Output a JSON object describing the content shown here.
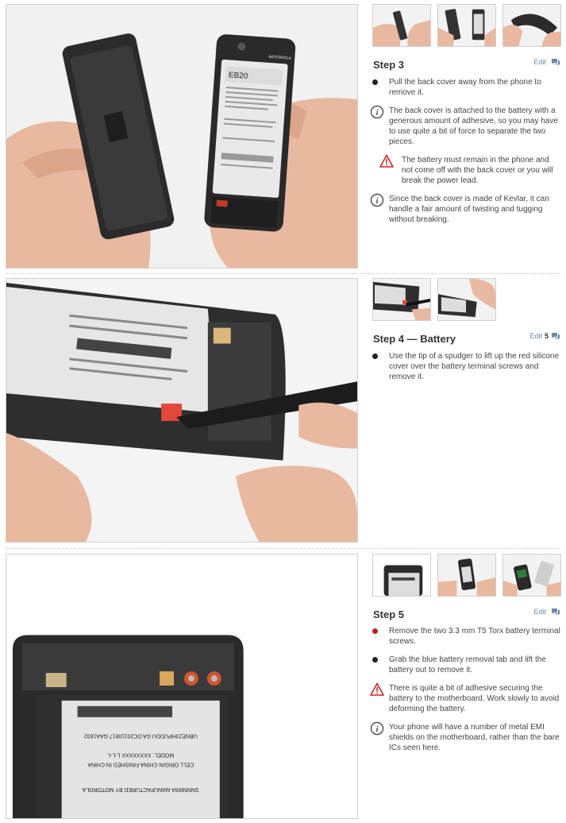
{
  "steps": [
    {
      "title": "Step 3",
      "edit_label": "Edit",
      "comment_count": "",
      "lines": [
        {
          "type": "bullet",
          "color": "#222222",
          "text": "Pull the back cover away from the phone to remove it."
        },
        {
          "type": "info",
          "text": "The back cover is attached to the battery with a generous amount of adhesive, so you may have to use quite a bit of force to separate the two pieces."
        },
        {
          "type": "caution",
          "indent": true,
          "text": "The battery must remain in the phone and not come off with the back cover or you will break the power lead."
        },
        {
          "type": "info",
          "text": "Since the back cover is made of Kevlar, it can handle a fair amount of twisting and tugging without breaking."
        }
      ]
    },
    {
      "title": "Step 4 — Battery",
      "edit_label": "Edit",
      "comment_count": "5",
      "lines": [
        {
          "type": "bullet",
          "color": "#222222",
          "text": "Use the tip of a spudger to lift up the red silicone cover over the battery terminal screws and remove it."
        }
      ]
    },
    {
      "title": "Step 5",
      "edit_label": "Edit",
      "comment_count": "",
      "lines": [
        {
          "type": "bullet",
          "color": "#b3261e",
          "text": "Remove the two 3.3 mm T5 Torx battery terminal screws."
        },
        {
          "type": "bullet",
          "color": "#222222",
          "text": "Grab the blue battery removal tab and lift the battery out to remove it."
        },
        {
          "type": "caution",
          "text": "There is quite a bit of adhesive securing the battery to the motherboard. Work slowly to avoid deforming the battery."
        },
        {
          "type": "info",
          "text": "Your phone will have a number of metal EMI shields on the motherboard, rather than the bare ICs seen here."
        }
      ]
    }
  ],
  "photo_text": {
    "step3_model": "EB20",
    "step3_brand": "MOTOROLA",
    "step5_battery_line1": "SNN5899A     MANUFACTURED BY MOTOROLA",
    "step5_battery_line2": "CELL ORIGIN CHINA FINISHED IN CHINA",
    "step5_battery_line3": "MODEL: XXXXXXXX     L-L-L",
    "step5_battery_line4": "UBNE23HPUDDU GA DC20110817 GAA1832"
  },
  "colors": {
    "link": "#6a8aa8",
    "red_bullet": "#b3261e",
    "caution": "#c62828",
    "info": "#555555"
  }
}
